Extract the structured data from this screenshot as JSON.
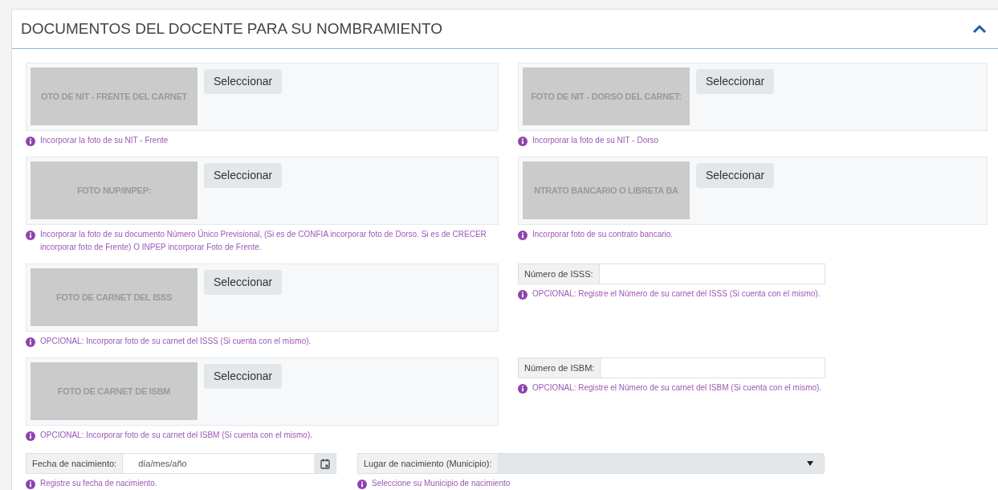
{
  "section": {
    "title": "DOCUMENTOS DEL DOCENTE PARA SU NOMBRAMIENTO",
    "expanded": true
  },
  "items": [
    {
      "kind": "upload",
      "image_text": "OTO DE NIT - FRENTE DEL CARNET",
      "button": "Seleccionar",
      "hint": "Incorporar la foto de su NIT - Frente"
    },
    {
      "kind": "upload",
      "image_text": "FOTO DE NIT - DORSO DEL CARNET:",
      "button": "Seleccionar",
      "hint": "Incorporar la foto de su NIT - Dorso"
    },
    {
      "kind": "upload",
      "image_text": "FOTO NUP/INPEP:",
      "button": "Seleccionar",
      "hint": "Incorporar la foto de su documento Número Único Previsional, (Si es de CONFIA incorporar foto de Dorso. Si es de CRECER incorporar foto de Frente) O INPEP incorporar Foto de Frente."
    },
    {
      "kind": "upload",
      "image_text": "NTRATO BANCARIO O LIBRETA BA",
      "button": "Seleccionar",
      "hint": "Incorporar foto de su contrato bancario."
    },
    {
      "kind": "upload",
      "image_text": "FOTO DE CARNET DEL ISSS",
      "button": "Seleccionar",
      "hint": "OPCIONAL: Incorporar foto de su carnet del ISSS (Si cuenta con el mismo)."
    },
    {
      "kind": "field",
      "label": "Número de ISSS:",
      "hint": "OPCIONAL: Registre el Número de su carnet del ISSS (Si cuenta con el mismo)."
    },
    {
      "kind": "upload",
      "image_text": "FOTO DE CARNET DE ISBM",
      "button": "Seleccionar",
      "hint": "OPCIONAL: Incorporar foto de su carnet del ISBM (Si cuenta con el mismo)."
    },
    {
      "kind": "field",
      "label": "Número de ISBM:",
      "hint": "OPCIONAL: Registre el Número de su carnet del ISBM (Si cuenta con el mismo)."
    }
  ],
  "birth_date": {
    "label": "Fecha de nacimiento:",
    "placeholder": "día/mes/año",
    "hint": "Registre su fecha de nacimiento."
  },
  "birth_place": {
    "label": "Lugar de nacimiento (Municipio):",
    "hint": "Seleccione su Municipio de nacimiento"
  }
}
